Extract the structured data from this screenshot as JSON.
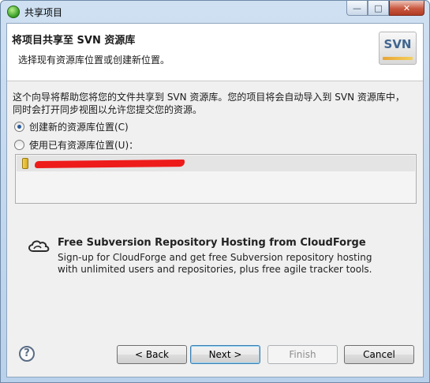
{
  "window": {
    "title": "共享项目",
    "controls": {
      "minimize": "—",
      "maximize": "□",
      "close": "✕"
    }
  },
  "banner": {
    "title": "将项目共享至 SVN 资源库",
    "description": "选择现有资源库位置或创建新位置。",
    "logo_text": "SVN"
  },
  "intro": {
    "line1": "这个向导将帮助您将您的文件共享到 SVN 资源库。您的项目将会自动导入到 SVN 资源库中，",
    "line2": "同时会打开同步视图以允许您提交您的资源。"
  },
  "options": {
    "create_new": {
      "label": "创建新的资源库位置(C)",
      "selected": true
    },
    "use_existing": {
      "label": "使用已有资源库位置(U)：",
      "selected": false
    }
  },
  "repository_list": {
    "items": [
      {
        "label": "",
        "redacted": true
      }
    ]
  },
  "cloudforge": {
    "title": "Free Subversion Repository Hosting from CloudForge",
    "desc_line1": "Sign-up for CloudForge and get free Subversion repository hosting",
    "desc_line2": "with unlimited users and repositories, plus free agile tracker tools."
  },
  "buttons": {
    "help": "?",
    "back": "< Back",
    "next": "Next >",
    "finish": "Finish",
    "cancel": "Cancel"
  }
}
